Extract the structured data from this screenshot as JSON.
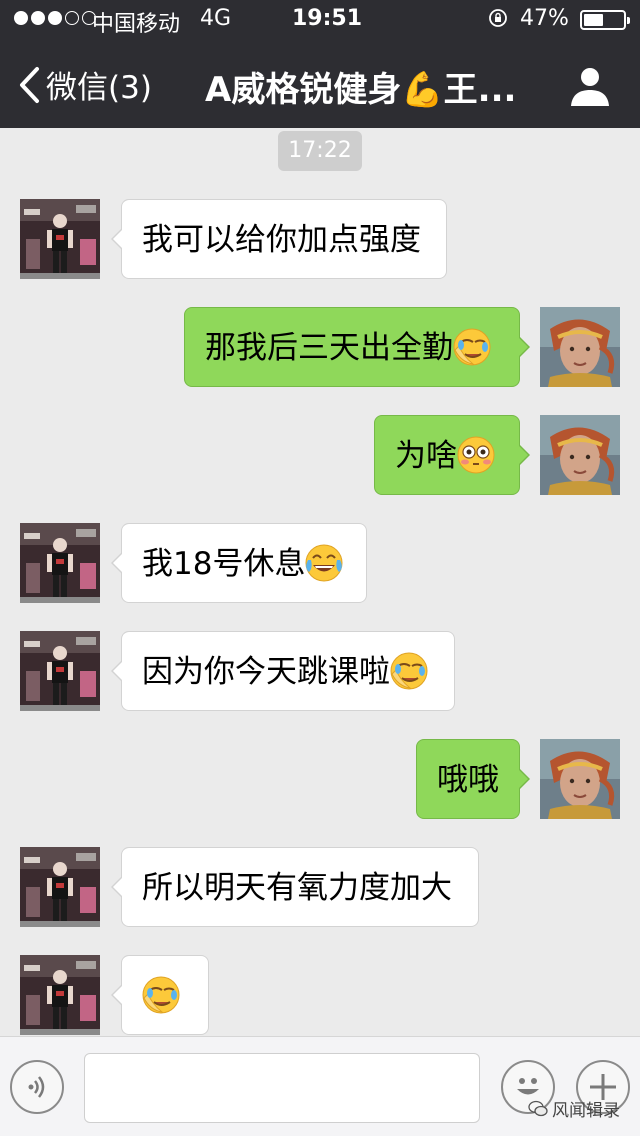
{
  "status_bar": {
    "carrier": "中国移动",
    "network": "4G",
    "time": "19:51",
    "battery_percent": "47%",
    "signal_bars_filled": 3,
    "signal_bars_total": 5,
    "battery_level": 0.47
  },
  "nav": {
    "back_label": "微信(3)",
    "title": "A威格锐健身💪王..."
  },
  "timestamp": "17:22",
  "messages": [
    {
      "side": "left",
      "text": "我可以给你加点强度",
      "emoji": ""
    },
    {
      "side": "right",
      "text": "那我后三天出全勤",
      "emoji": "facepalm-emoji"
    },
    {
      "side": "right",
      "text": "为啥",
      "emoji": "flushed-emoji"
    },
    {
      "side": "left",
      "text": "我18号休息",
      "emoji": "tears-of-joy-emoji"
    },
    {
      "side": "left",
      "text": "因为你今天跳课啦",
      "emoji": "facepalm-emoji"
    },
    {
      "side": "right",
      "text": "哦哦",
      "emoji": ""
    },
    {
      "side": "left",
      "text": "所以明天有氧力度加大",
      "emoji": ""
    },
    {
      "side": "left",
      "text": "",
      "emoji": "facepalm-emoji"
    }
  ],
  "input": {
    "placeholder": ""
  },
  "watermark": "风闻辑录",
  "colors": {
    "nav_bg": "#2d2d32",
    "chat_bg": "#ebebeb",
    "sent_bubble": "#8fd85a",
    "received_bubble": "#ffffff"
  }
}
